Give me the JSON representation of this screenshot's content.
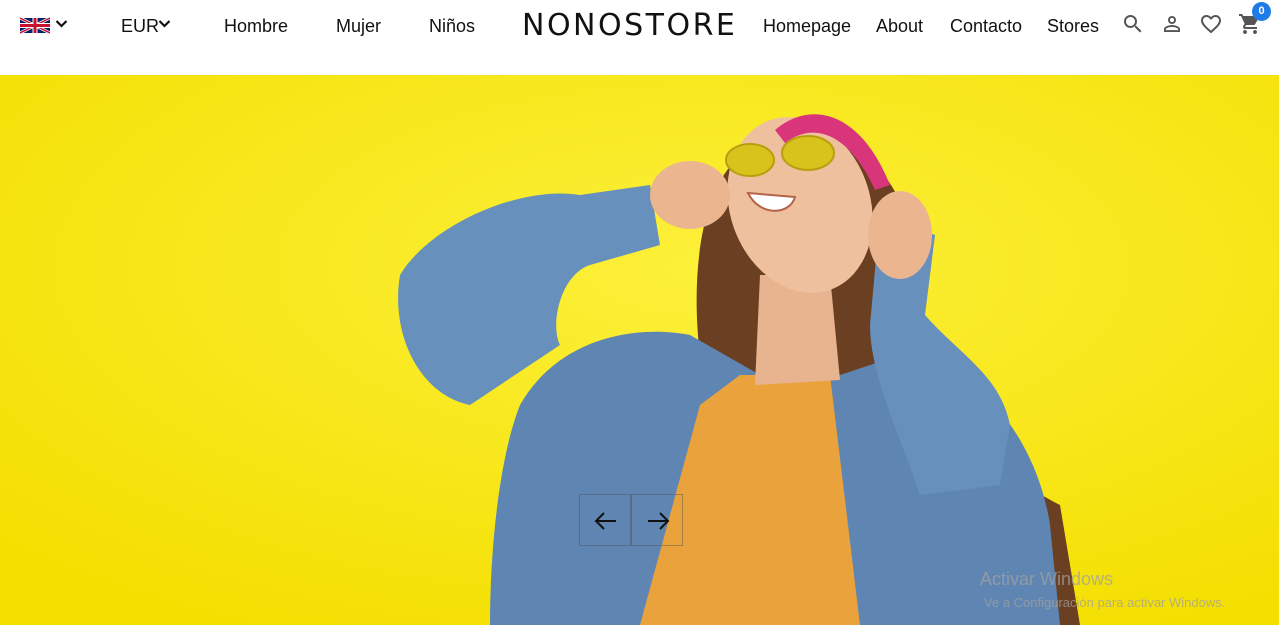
{
  "header": {
    "language": {
      "flag_icon": "uk-flag-icon",
      "dropdown_icon": "chevron-down-icon"
    },
    "currency": {
      "label": "EUR",
      "dropdown_icon": "chevron-down-icon"
    },
    "left_nav": [
      {
        "label": "Hombre"
      },
      {
        "label": "Mujer"
      },
      {
        "label": "Niños"
      }
    ],
    "logo": "NONOSTORE",
    "right_nav": [
      {
        "label": "Homepage"
      },
      {
        "label": "About"
      },
      {
        "label": "Contacto"
      },
      {
        "label": "Stores"
      }
    ],
    "icons": {
      "search": "search-icon",
      "account": "user-icon",
      "wishlist": "heart-icon",
      "cart": "cart-icon"
    },
    "cart_count": "0",
    "badge_color": "#1e7be8"
  },
  "hero": {
    "background_color": "#f8e712",
    "image_description": "woman in denim jacket and sunglasses laughing against yellow wall",
    "prev_icon": "arrow-left-icon",
    "next_icon": "arrow-right-icon"
  },
  "watermark": {
    "title": "Activar Windows",
    "subtitle": "Ve a Configuración para activar Windows."
  }
}
